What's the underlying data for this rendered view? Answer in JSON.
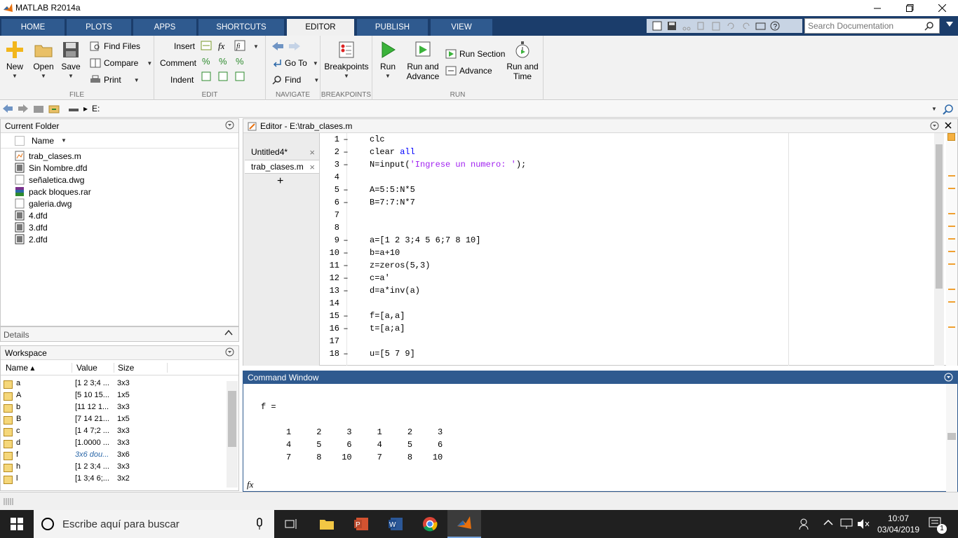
{
  "window": {
    "title": "MATLAB R2014a"
  },
  "ribbon_tabs": [
    "HOME",
    "PLOTS",
    "APPS",
    "SHORTCUTS",
    "EDITOR",
    "PUBLISH",
    "VIEW"
  ],
  "search": {
    "placeholder": "Search Documentation"
  },
  "file_section": {
    "label": "FILE",
    "new": "New",
    "open": "Open",
    "save": "Save",
    "find_files": "Find Files",
    "compare": "Compare",
    "print": "Print"
  },
  "edit_section": {
    "label": "EDIT",
    "insert": "Insert",
    "comment": "Comment",
    "indent": "Indent"
  },
  "navigate_section": {
    "label": "NAVIGATE",
    "goto": "Go To",
    "find": "Find"
  },
  "breakpoints_section": {
    "label": "BREAKPOINTS",
    "breakpoints": "Breakpoints"
  },
  "run_section": {
    "label": "RUN",
    "run": "Run",
    "run_and_advance_1": "Run and",
    "run_and_advance_2": "Advance",
    "run_section": "Run Section",
    "advance": "Advance",
    "run_and_time_1": "Run and",
    "run_and_time_2": "Time"
  },
  "address": {
    "path": "E:"
  },
  "current_folder": {
    "title": "Current Folder",
    "col_name": "Name",
    "files": [
      "trab_clases.m",
      "Sin Nombre.dfd",
      "señaletica.dwg",
      "pack bloques.rar",
      "galeria.dwg",
      "4.dfd",
      "3.dfd",
      "2.dfd"
    ]
  },
  "details": {
    "title": "Details"
  },
  "workspace": {
    "title": "Workspace",
    "col_name": "Name",
    "col_value": "Value",
    "col_size": "Size",
    "rows": [
      {
        "name": "a",
        "value": "[1 2 3;4 ...",
        "size": "3x3"
      },
      {
        "name": "A",
        "value": "[5 10 15...",
        "size": "1x5"
      },
      {
        "name": "b",
        "value": "[11 12 1...",
        "size": "3x3"
      },
      {
        "name": "B",
        "value": "[7 14 21...",
        "size": "1x5"
      },
      {
        "name": "c",
        "value": "[1 4 7;2 ...",
        "size": "3x3"
      },
      {
        "name": "d",
        "value": "[1.0000 ...",
        "size": "3x3"
      },
      {
        "name": "f",
        "value": "3x6 dou...",
        "size": "3x6"
      },
      {
        "name": "h",
        "value": "[1 2 3;4 ...",
        "size": "3x3"
      },
      {
        "name": "l",
        "value": "[1 3;4 6;...",
        "size": "3x2"
      }
    ]
  },
  "editor": {
    "title": "Editor - E:\\trab_clases.m",
    "tabs": [
      "Untitled4*",
      "trab_clases.m"
    ],
    "add": "+",
    "lines": [
      {
        "n": "1",
        "dash": true,
        "parts": [
          [
            "clc",
            ""
          ]
        ]
      },
      {
        "n": "2",
        "dash": true,
        "parts": [
          [
            "clear ",
            ""
          ],
          [
            "all",
            "kw"
          ]
        ]
      },
      {
        "n": "3",
        "dash": true,
        "parts": [
          [
            "N=input(",
            ""
          ],
          [
            "'Ingrese un numero: '",
            "str"
          ],
          [
            ");",
            ""
          ]
        ]
      },
      {
        "n": "4",
        "dash": false,
        "parts": []
      },
      {
        "n": "5",
        "dash": true,
        "parts": [
          [
            "A=5:5:N*5",
            ""
          ]
        ]
      },
      {
        "n": "6",
        "dash": true,
        "parts": [
          [
            "B=7:7:N*7",
            ""
          ]
        ]
      },
      {
        "n": "7",
        "dash": false,
        "parts": []
      },
      {
        "n": "8",
        "dash": false,
        "parts": []
      },
      {
        "n": "9",
        "dash": true,
        "parts": [
          [
            "a=[1 2 3;4 5 6;7 8 10]",
            ""
          ]
        ]
      },
      {
        "n": "10",
        "dash": true,
        "parts": [
          [
            "b=a+10",
            ""
          ]
        ]
      },
      {
        "n": "11",
        "dash": true,
        "parts": [
          [
            "z=zeros(5,3)",
            ""
          ]
        ]
      },
      {
        "n": "12",
        "dash": true,
        "parts": [
          [
            "c=a'",
            ""
          ]
        ]
      },
      {
        "n": "13",
        "dash": true,
        "parts": [
          [
            "d=a*inv(a)",
            ""
          ]
        ]
      },
      {
        "n": "14",
        "dash": false,
        "parts": []
      },
      {
        "n": "15",
        "dash": true,
        "parts": [
          [
            "f=[a,a]",
            ""
          ]
        ]
      },
      {
        "n": "16",
        "dash": true,
        "parts": [
          [
            "t=[a;a]",
            ""
          ]
        ]
      },
      {
        "n": "17",
        "dash": false,
        "parts": []
      },
      {
        "n": "18",
        "dash": true,
        "parts": [
          [
            "u=[5 7 9]",
            ""
          ]
        ]
      }
    ]
  },
  "command_window": {
    "title": "Command Window",
    "var_line": "f =",
    "rows": [
      "     1     2     3     1     2     3",
      "     4     5     6     4     5     6",
      "     7     8    10     7     8    10"
    ],
    "fx": "fx"
  },
  "taskbar": {
    "search_placeholder": "Escribe aquí para buscar",
    "time": "10:07",
    "date": "03/04/2019",
    "notif": "1"
  }
}
